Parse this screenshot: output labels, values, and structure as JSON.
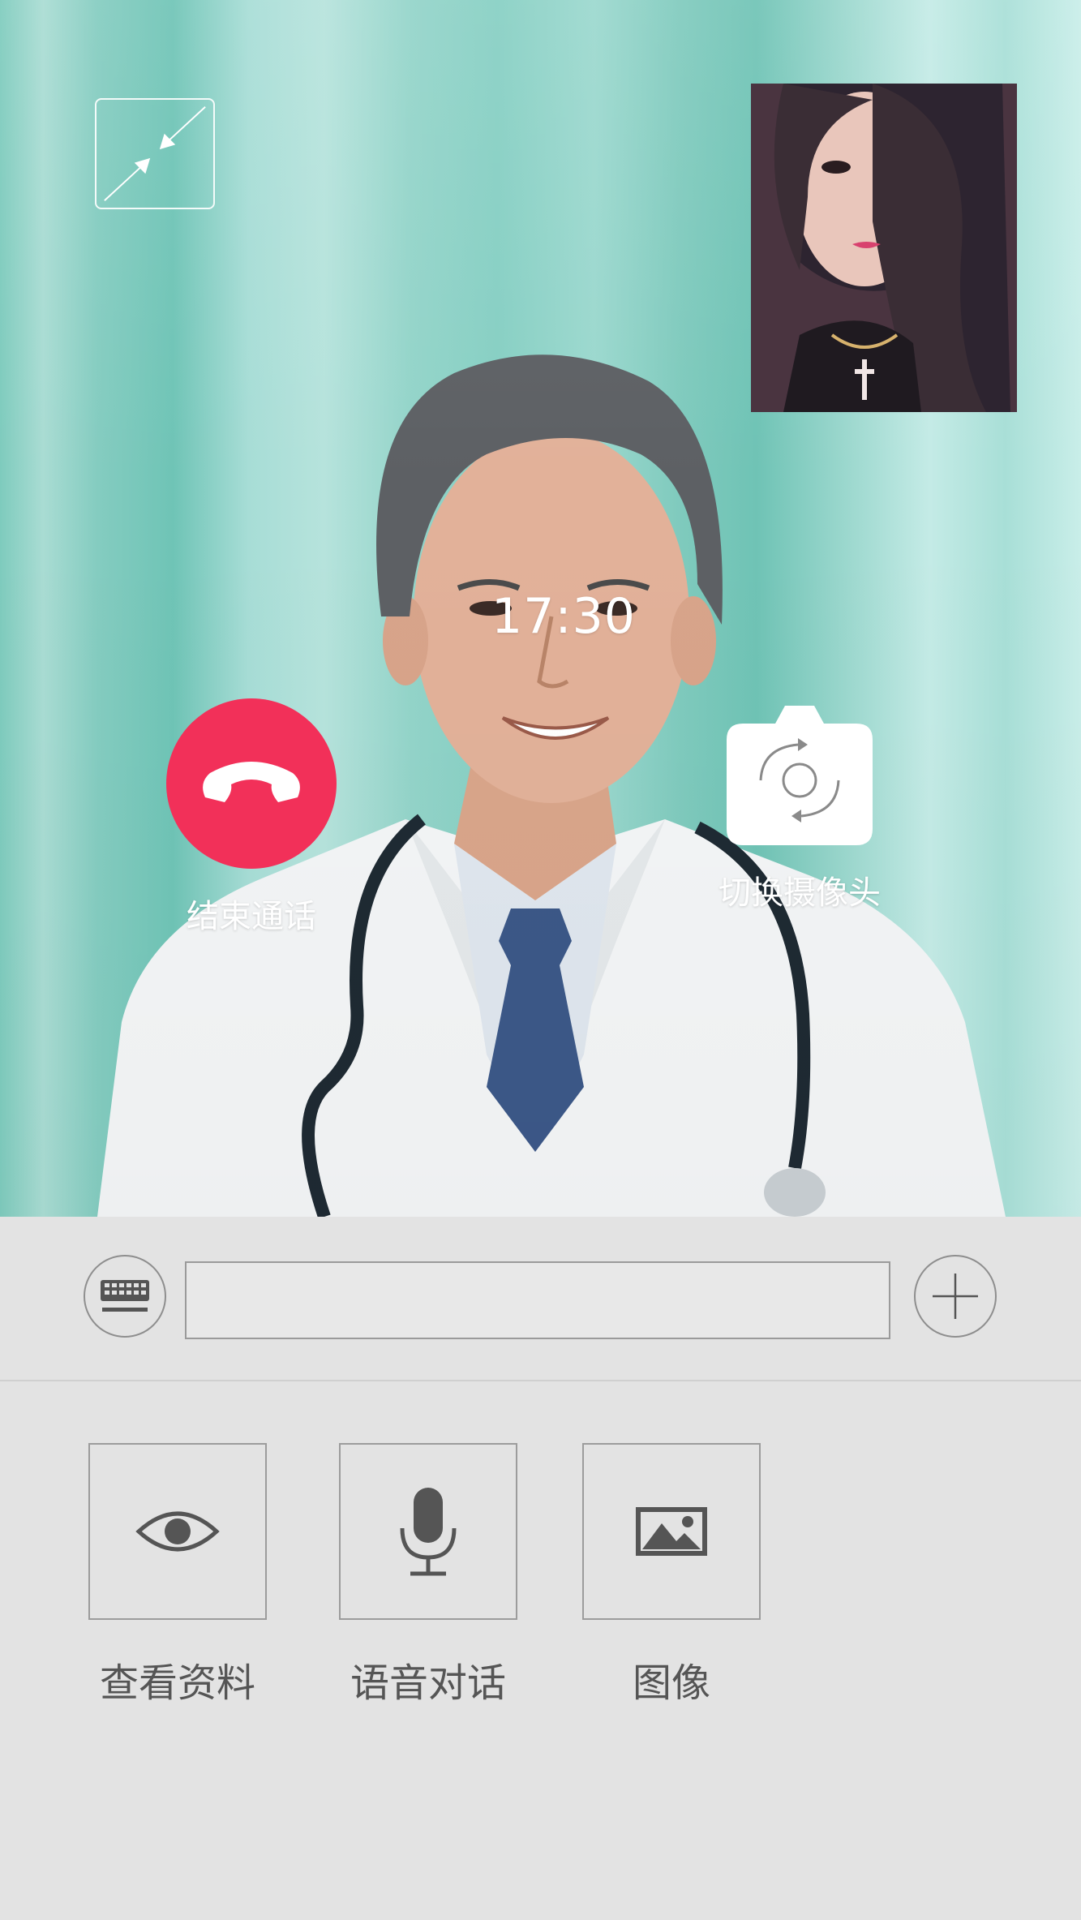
{
  "call": {
    "timer": "17:30",
    "end_call_label": "结束通话",
    "switch_camera_label": "切换摄像头"
  },
  "input_bar": {
    "placeholder": ""
  },
  "functions": [
    {
      "label": "查看资料",
      "icon": "eye-icon"
    },
    {
      "label": "语音对话",
      "icon": "microphone-icon"
    },
    {
      "label": "图像",
      "icon": "image-icon"
    }
  ],
  "colors": {
    "end_call": "#f23059",
    "panel_bg": "#e3e3e3",
    "label_text": "#555555"
  }
}
